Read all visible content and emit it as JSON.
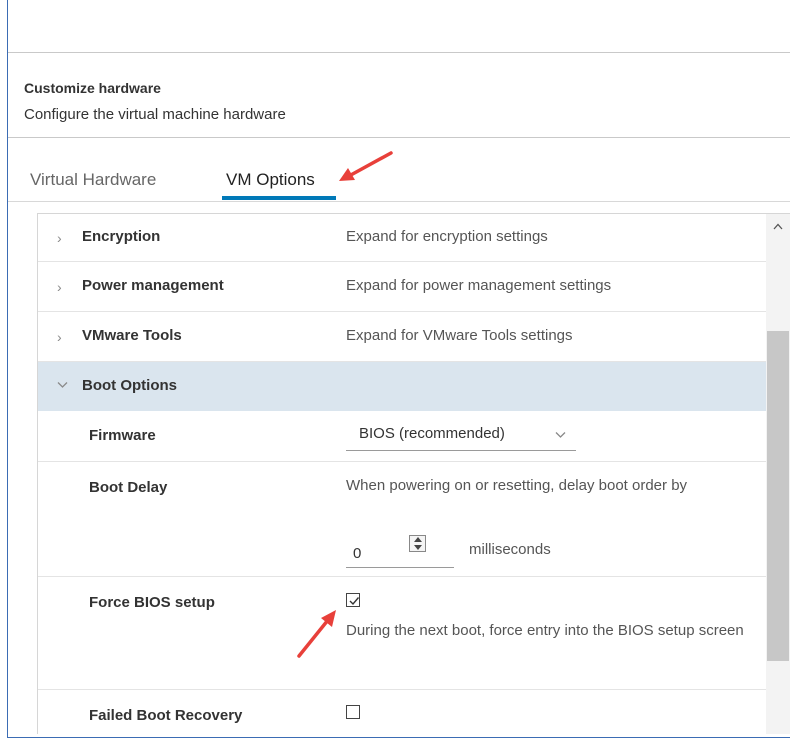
{
  "header": {
    "title": "Customize hardware",
    "subtitle": "Configure the virtual machine hardware"
  },
  "tabs": [
    {
      "label": "Virtual Hardware",
      "active": false
    },
    {
      "label": "VM Options",
      "active": true
    }
  ],
  "rows": {
    "encryption": {
      "label": "Encryption",
      "description": "Expand for encryption settings",
      "expanded": false
    },
    "power": {
      "label": "Power management",
      "description": "Expand for power management settings",
      "expanded": false
    },
    "tools": {
      "label": "VMware Tools",
      "description": "Expand for VMware Tools settings",
      "expanded": false
    },
    "boot": {
      "label": "Boot Options",
      "expanded": true
    }
  },
  "boot_options": {
    "firmware": {
      "label": "Firmware",
      "value": "BIOS (recommended)"
    },
    "boot_delay": {
      "label": "Boot Delay",
      "description": "When powering on or resetting, delay boot order by",
      "value": "0",
      "unit": "milliseconds"
    },
    "force_bios": {
      "label": "Force BIOS setup",
      "checked": true,
      "description": "During the next boot, force entry into the BIOS setup screen"
    },
    "failed_boot_recovery": {
      "label": "Failed Boot Recovery",
      "checked": false
    }
  },
  "colors": {
    "accent": "#0079b8",
    "annotation_arrow": "#e8403a",
    "expanded_row_bg": "#dae5ee"
  },
  "icons": {
    "collapsed": "chevron-right-icon",
    "expanded": "chevron-down-icon",
    "dropdown": "chevron-down-icon",
    "scroll_up": "caret-up-icon"
  }
}
